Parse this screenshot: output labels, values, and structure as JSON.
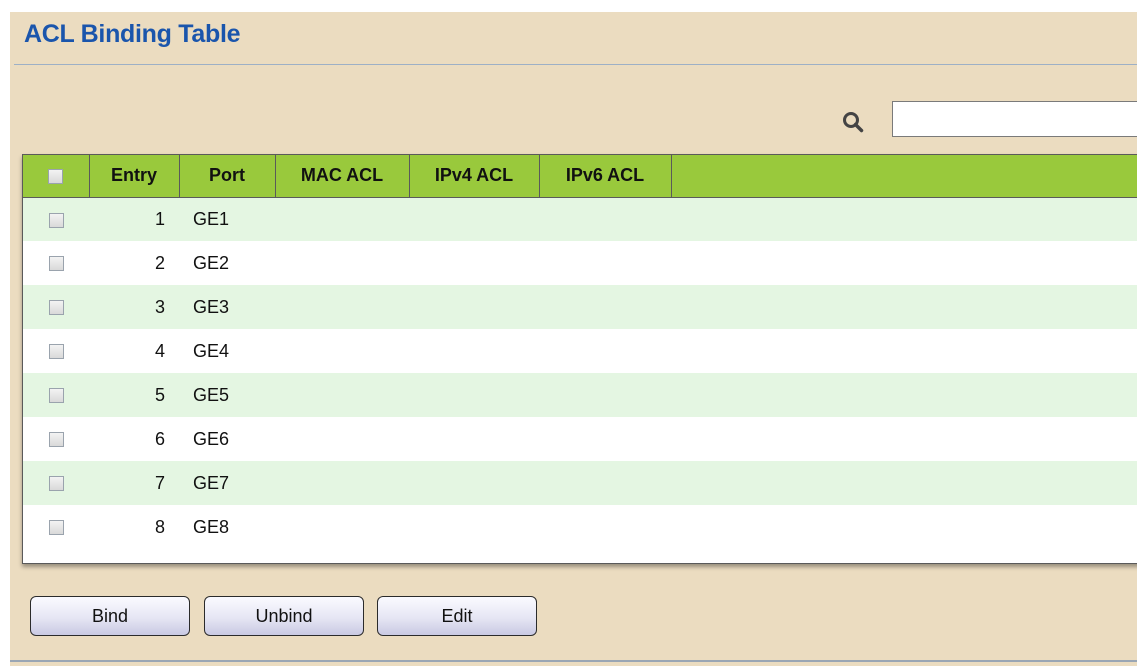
{
  "page": {
    "title": "ACL Binding Table"
  },
  "search": {
    "value": ""
  },
  "table": {
    "columns": [
      "Entry",
      "Port",
      "MAC ACL",
      "IPv4 ACL",
      "IPv6 ACL"
    ],
    "rows": [
      {
        "entry": "1",
        "port": "GE1",
        "mac_acl": "",
        "ipv4_acl": "",
        "ipv6_acl": ""
      },
      {
        "entry": "2",
        "port": "GE2",
        "mac_acl": "",
        "ipv4_acl": "",
        "ipv6_acl": ""
      },
      {
        "entry": "3",
        "port": "GE3",
        "mac_acl": "",
        "ipv4_acl": "",
        "ipv6_acl": ""
      },
      {
        "entry": "4",
        "port": "GE4",
        "mac_acl": "",
        "ipv4_acl": "",
        "ipv6_acl": ""
      },
      {
        "entry": "5",
        "port": "GE5",
        "mac_acl": "",
        "ipv4_acl": "",
        "ipv6_acl": ""
      },
      {
        "entry": "6",
        "port": "GE6",
        "mac_acl": "",
        "ipv4_acl": "",
        "ipv6_acl": ""
      },
      {
        "entry": "7",
        "port": "GE7",
        "mac_acl": "",
        "ipv4_acl": "",
        "ipv6_acl": ""
      },
      {
        "entry": "8",
        "port": "GE8",
        "mac_acl": "",
        "ipv4_acl": "",
        "ipv6_acl": ""
      }
    ]
  },
  "buttons": {
    "bind": "Bind",
    "unbind": "Unbind",
    "edit": "Edit"
  },
  "colors": {
    "title": "#1a55ac",
    "header_bg": "#99c93c",
    "row_alt_bg": "#e4f6e2",
    "panel_bg": "#ebdcc0"
  },
  "icons": {
    "search": "search-icon"
  }
}
